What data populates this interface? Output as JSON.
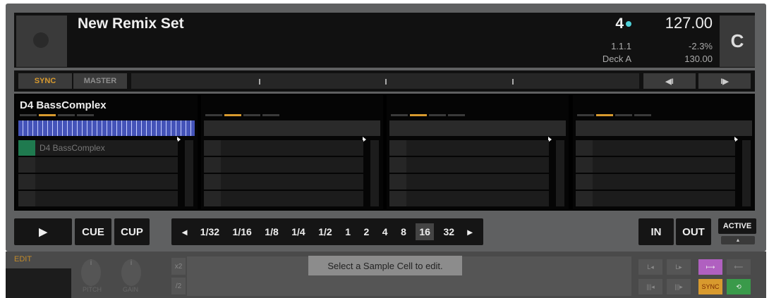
{
  "header": {
    "title": "New Remix Set",
    "beats": "4",
    "position": "1.1.1",
    "deck": "Deck A",
    "bpm": "127.00",
    "tempo_offset": "-2.3%",
    "original_bpm": "130.00",
    "key": "C"
  },
  "transport": {
    "sync": "SYNC",
    "master": "MASTER",
    "prev": "◀I",
    "next": "I▶"
  },
  "slots": [
    {
      "name": "D4 BassComplex",
      "cells": [
        "D4 BassComplex",
        "",
        "",
        ""
      ],
      "active_page": 1
    },
    {
      "name": "",
      "cells": [
        "",
        "",
        "",
        ""
      ],
      "active_page": 1
    },
    {
      "name": "",
      "cells": [
        "",
        "",
        "",
        ""
      ],
      "active_page": 1
    },
    {
      "name": "",
      "cells": [
        "",
        "",
        "",
        ""
      ],
      "active_page": 1
    }
  ],
  "controls": {
    "play": "▶",
    "cue": "CUE",
    "cup": "CUP",
    "loop_prev": "◂",
    "loop_next": "▸",
    "loop_sizes": [
      "1/32",
      "1/16",
      "1/8",
      "1/4",
      "1/2",
      "1",
      "2",
      "4",
      "8",
      "16",
      "32"
    ],
    "loop_selected": "16",
    "in": "IN",
    "out": "OUT",
    "active": "ACTIVE",
    "active_arrow": "▲"
  },
  "edit": {
    "label": "EDIT",
    "pitch": "PITCH",
    "gain": "GAIN",
    "x2": "x2",
    "div2": "/2",
    "tooltip": "Select a Sample Cell to edit.",
    "sync": "SYNC"
  },
  "colors": {
    "accent_orange": "#d89a2e",
    "key_dot": "#4fd0d8",
    "loop_green": "#1f7a4f",
    "waveform": "#4453b8",
    "edit_purple": "#b060c0"
  }
}
